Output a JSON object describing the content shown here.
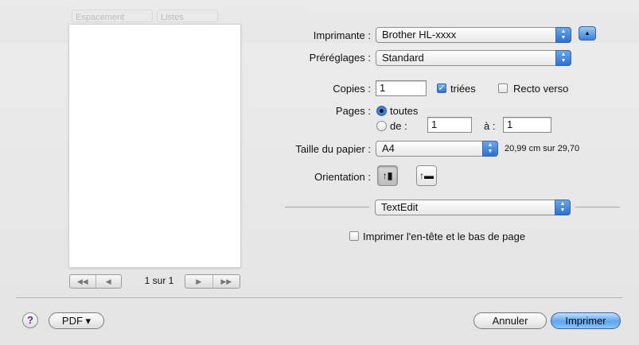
{
  "printer": {
    "label": "Imprimante :",
    "value": "Brother HL-xxxx"
  },
  "presets": {
    "label": "Préréglages :",
    "value": "Standard"
  },
  "copies": {
    "label": "Copies :",
    "value": "1",
    "collated_label": "triées",
    "duplex_label": "Recto verso"
  },
  "pages": {
    "label": "Pages :",
    "all_label": "toutes",
    "from_label": "de :",
    "from_value": "1",
    "to_label": "à :",
    "to_value": "1"
  },
  "paper": {
    "label": "Taille du papier :",
    "value": "A4",
    "size_text": "20,99 cm sur 29,70"
  },
  "orientation": {
    "label": "Orientation :"
  },
  "section": {
    "value": "TextEdit"
  },
  "header_footer": {
    "label": "Imprimer l'en-tête et le bas de page"
  },
  "preview": {
    "page_label": "1 sur 1"
  },
  "footer": {
    "help": "?",
    "pdf": "PDF ▾",
    "cancel": "Annuler",
    "print": "Imprimer"
  },
  "ghost": {
    "item1": "Espacement",
    "item2": "Listes"
  },
  "icons": {
    "arrows": "popup-arrows-icon",
    "collapse": "disclosure-up-icon",
    "portrait": "portrait-orientation-icon",
    "landscape": "landscape-orientation-icon"
  }
}
